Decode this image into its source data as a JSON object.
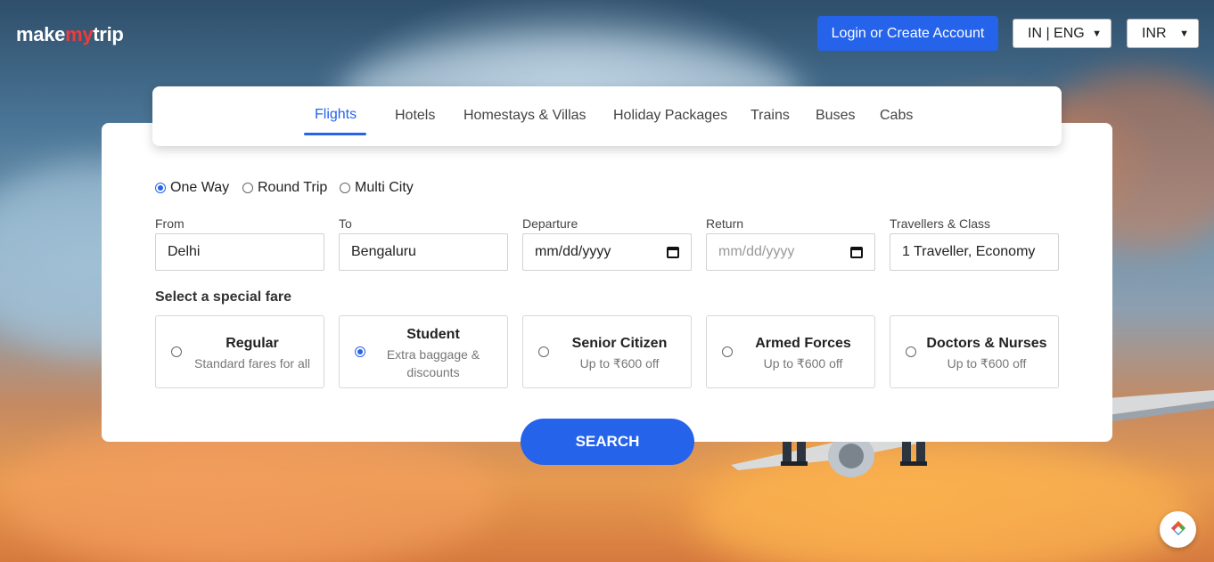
{
  "brand": {
    "make": "make",
    "my": "my",
    "trip": "trip"
  },
  "header": {
    "login_label": "Login or Create Account",
    "language": "IN | ENG",
    "currency": "INR"
  },
  "tabs": [
    {
      "label": "Flights",
      "active": true
    },
    {
      "label": "Hotels"
    },
    {
      "label": "Homestays & Villas"
    },
    {
      "label": "Holiday Packages"
    },
    {
      "label": "Trains"
    },
    {
      "label": "Buses"
    },
    {
      "label": "Cabs"
    }
  ],
  "trip_types": [
    {
      "label": "One Way",
      "checked": true
    },
    {
      "label": "Round Trip",
      "checked": false
    },
    {
      "label": "Multi City",
      "checked": false
    }
  ],
  "fields": {
    "from": {
      "label": "From",
      "value": "Delhi"
    },
    "to": {
      "label": "To",
      "value": "Bengaluru"
    },
    "departure": {
      "label": "Departure",
      "value": "mm/dd/yyyy"
    },
    "return": {
      "label": "Return",
      "placeholder": "mm/dd/yyyy"
    },
    "travellers": {
      "label": "Travellers & Class",
      "value": "1 Traveller, Economy"
    }
  },
  "special_fare": {
    "title": "Select a special fare",
    "options": [
      {
        "title": "Regular",
        "subtitle": "Standard fares for all",
        "checked": false
      },
      {
        "title": "Student",
        "subtitle": "Extra baggage & discounts",
        "checked": true
      },
      {
        "title": "Senior Citizen",
        "subtitle": "Up to ₹600 off",
        "checked": false
      },
      {
        "title": "Armed Forces",
        "subtitle": "Up to ₹600 off",
        "checked": false
      },
      {
        "title": "Doctors & Nurses",
        "subtitle": "Up to ₹600 off",
        "checked": false
      }
    ]
  },
  "search_label": "SEARCH",
  "colors": {
    "accent": "#2563eb",
    "brand_red": "#ef3b3b"
  },
  "icons": [
    "chevron-down-icon",
    "calendar-icon",
    "helper-widget-icon"
  ]
}
